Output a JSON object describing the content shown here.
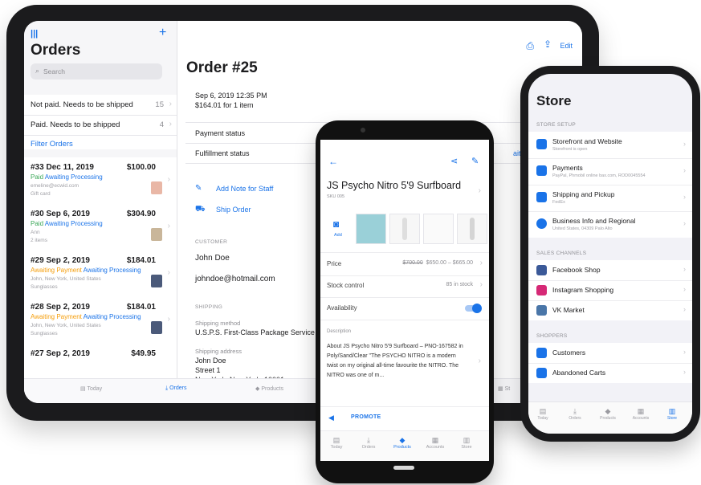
{
  "tablet": {
    "sidebar": {
      "title": "Orders",
      "search_placeholder": "Search",
      "filters": [
        {
          "label": "Not paid. Needs to be shipped",
          "count": "15"
        },
        {
          "label": "Paid. Needs to be shipped",
          "count": "4"
        }
      ],
      "filter_link": "Filter Orders",
      "orders": [
        {
          "num": "#33",
          "date": "Dec 11, 2019",
          "amount": "$100.00",
          "status1": "Paid",
          "status2": "Awaiting Processing",
          "sub1": "emeline@ecwid.com",
          "sub2": "Gift card"
        },
        {
          "num": "#30",
          "date": "Sep 6, 2019",
          "amount": "$304.90",
          "status1": "Paid",
          "status2": "Awaiting Processing",
          "sub1": "Ann",
          "sub2": "2 items"
        },
        {
          "num": "#29",
          "date": "Sep 2, 2019",
          "amount": "$184.01",
          "status1": "Awaiting Payment",
          "status2": "Awaiting Processing",
          "sub1": "John, New York, United States",
          "sub2": "Sunglasses"
        },
        {
          "num": "#28",
          "date": "Sep 2, 2019",
          "amount": "$184.01",
          "status1": "Awaiting Payment",
          "status2": "Awaiting Processing",
          "sub1": "John, New York, United States",
          "sub2": "Sunglasses"
        },
        {
          "num": "#27",
          "date": "Sep 2, 2019",
          "amount": "$49.95",
          "status1": "",
          "status2": "",
          "sub1": "",
          "sub2": ""
        }
      ]
    },
    "main": {
      "title": "Order #25",
      "edit_label": "Edit",
      "date_line": "Sep 6, 2019 12:35 PM",
      "total_line": "$164.01 for 1 item",
      "payment_status_label": "Payment status",
      "fulfillment_status_label": "Fulfillment status",
      "fulfillment_value_fragment": "aiting",
      "add_note_label": "Add Note for Staff",
      "ship_order_label": "Ship Order",
      "customer_header": "CUSTOMER",
      "customer_name": "John Doe",
      "customer_email": "johndoe@hotmail.com",
      "shipping_header": "SHIPPING",
      "shipping_method_label": "Shipping method",
      "shipping_method_value": "U.S.P.S. First-Class Package Service",
      "shipping_address_label": "Shipping address",
      "address_lines": [
        "John Doe",
        "Street 1",
        "New York, New York, 10001"
      ]
    },
    "tabbar": [
      "Today",
      "Orders",
      "Products",
      "St"
    ]
  },
  "android": {
    "product_title": "JS Psycho Nitro 5'9 Surfboard",
    "sku": "SKU 005",
    "add_photo_label": "Add",
    "price_label": "Price",
    "price_old": "$700.00",
    "price_range": "$650.00 – $665.00",
    "stock_label": "Stock control",
    "stock_value": "85 in stock",
    "availability_label": "Availability",
    "availability_on": true,
    "description_header": "Description",
    "description_text": "About JS Psycho Nitro 5'9 Surfboard – PNO-167582 in Poly/Sand/Clear \"The PSYCHO NITRO is a modern twist on my original all-time favourite the NITRO. The NITRO was one of m...",
    "promote_label": "PROMOTE",
    "tabbar": [
      "Today",
      "Orders",
      "Products",
      "Accounts",
      "Store"
    ]
  },
  "iphone": {
    "title": "Store",
    "sections": [
      {
        "header": "STORE SETUP",
        "items": [
          {
            "title": "Storefront and Website",
            "subtitle": "Storefront is open",
            "icon": "storefront-icon"
          },
          {
            "title": "Payments",
            "subtitle": "PayPal, Phmobil online bax.com, ROD0045554",
            "icon": "payments-icon"
          },
          {
            "title": "Shipping and Pickup",
            "subtitle": "FedEx",
            "icon": "shipping-icon"
          },
          {
            "title": "Business Info and Regional",
            "subtitle": "United States, 04309 Palo Alto",
            "icon": "info-icon"
          }
        ]
      },
      {
        "header": "SALES CHANNELS",
        "items": [
          {
            "title": "Facebook Shop",
            "icon": "facebook-icon"
          },
          {
            "title": "Instagram Shopping",
            "icon": "instagram-icon"
          },
          {
            "title": "VK Market",
            "icon": "vk-icon"
          }
        ]
      },
      {
        "header": "SHOPPERS",
        "items": [
          {
            "title": "Customers",
            "icon": "customers-icon"
          },
          {
            "title": "Abandoned Carts",
            "icon": "cart-icon"
          }
        ]
      }
    ],
    "tabbar": [
      "Today",
      "Orders",
      "Products",
      "Accounts",
      "Store"
    ]
  },
  "colors": {
    "accent": "#1a73e8",
    "paid": "#3aa757",
    "awaiting": "#f59e0b",
    "bezel": "#1b1b1d"
  }
}
